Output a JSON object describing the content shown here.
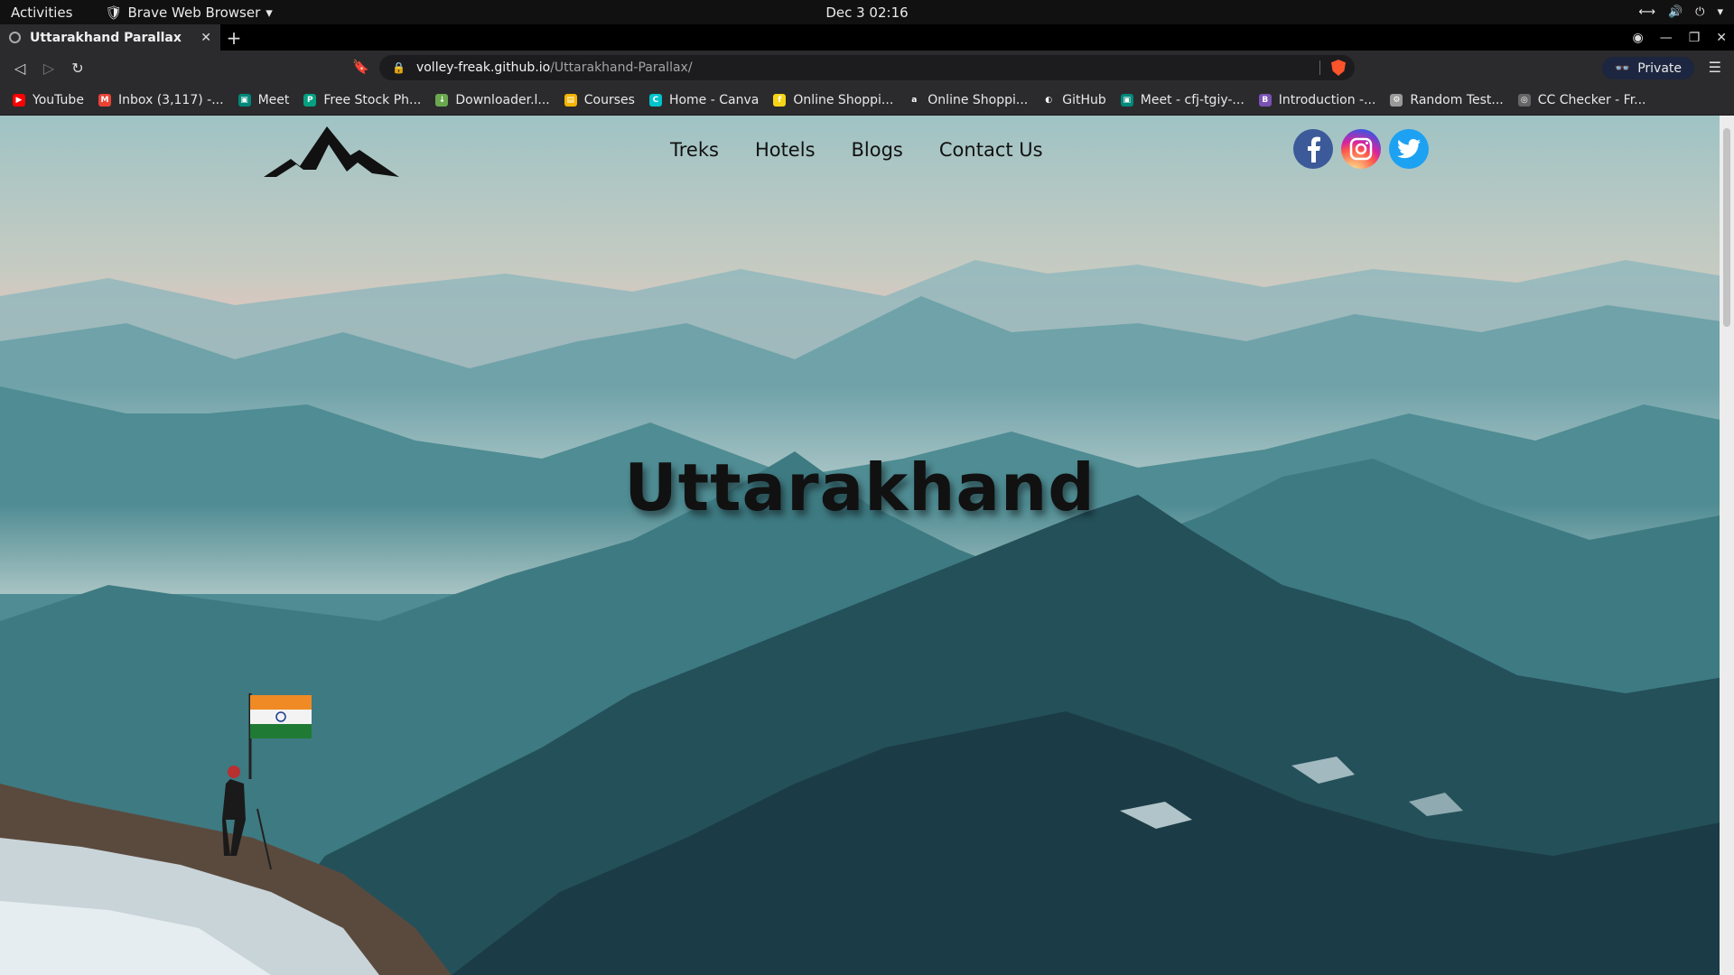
{
  "system_bar": {
    "activities": "Activities",
    "app_name": "Brave Web Browser",
    "clock": "Dec 3  02:16"
  },
  "tab": {
    "title": "Uttarakhand Parallax"
  },
  "address_bar": {
    "host": "volley-freak.github.io",
    "path": "/Uttarakhand-Parallax/"
  },
  "private_label": "Private",
  "bookmarks": [
    {
      "label": "YouTube",
      "color": "#ff0000",
      "icon": "youtube-icon"
    },
    {
      "label": "Inbox (3,117) -...",
      "color": "#ea4335",
      "icon": "gmail-icon"
    },
    {
      "label": "Meet",
      "color": "#00897b",
      "icon": "meet-icon"
    },
    {
      "label": "Free Stock Ph...",
      "color": "#05a081",
      "icon": "pexels-icon"
    },
    {
      "label": "Downloader.l...",
      "color": "#6aa84f",
      "icon": "downloader-icon"
    },
    {
      "label": "Courses",
      "color": "#f4b400",
      "icon": "courses-icon"
    },
    {
      "label": "Home - Canva",
      "color": "#00c4cc",
      "icon": "canva-icon"
    },
    {
      "label": "Online Shoppi...",
      "color": "#f7d417",
      "icon": "flipkart-icon"
    },
    {
      "label": "Online Shoppi...",
      "color": "#ffffff",
      "icon": "amazon-icon"
    },
    {
      "label": "GitHub",
      "color": "#ffffff",
      "icon": "github-icon"
    },
    {
      "label": "Meet - cfj-tgiy-...",
      "color": "#00897b",
      "icon": "meet-icon"
    },
    {
      "label": "Introduction -...",
      "color": "#7952b3",
      "icon": "bootstrap-icon"
    },
    {
      "label": "Random Test...",
      "color": "#999999",
      "icon": "gear-icon"
    },
    {
      "label": "CC Checker - Fr...",
      "color": "#666666",
      "icon": "cc-checker-icon"
    }
  ],
  "site": {
    "nav": [
      "Treks",
      "Hotels",
      "Blogs",
      "Contact Us"
    ],
    "hero_title": "Uttarakhand",
    "social": [
      "facebook-icon",
      "instagram-icon",
      "twitter-icon"
    ]
  },
  "colors": {
    "sky_top": "#9fc3c4",
    "sky_glow": "#e8c4bd",
    "mountain_teal": "#3c7d86",
    "mountain_dark": "#1e3a44"
  }
}
